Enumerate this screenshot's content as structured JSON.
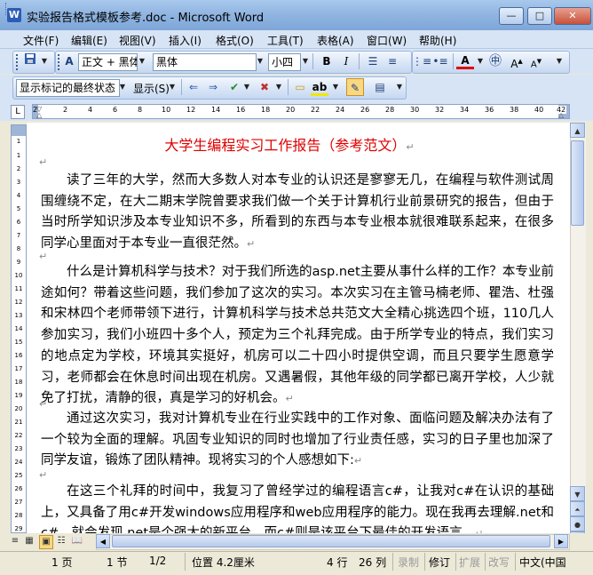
{
  "window": {
    "title": "实验报告格式模板参考.doc - Microsoft Word",
    "app_icon": "W",
    "minimize_glyph": "—",
    "maximize_glyph": "□",
    "close_glyph": "✕"
  },
  "menu": [
    "文件(F)",
    "编辑(E)",
    "视图(V)",
    "插入(I)",
    "格式(O)",
    "工具(T)",
    "表格(A)",
    "窗口(W)",
    "帮助(H)"
  ],
  "formatting": {
    "style": "正文 + 黑体",
    "font": "黑体",
    "size": "小四",
    "bold_glyph": "B",
    "italic_glyph": "I"
  },
  "reviewing": {
    "display": "显示标记的最终状态",
    "show": "显示(S)"
  },
  "ruler": {
    "corner_glyph": "L",
    "ticks": [
      "2",
      "2",
      "4",
      "6",
      "8",
      "10",
      "12",
      "14",
      "16",
      "18",
      "20",
      "22",
      "24",
      "26",
      "28",
      "30",
      "32",
      "34",
      "36",
      "38",
      "40",
      "42"
    ]
  },
  "vruler_ticks": [
    "1",
    "1",
    "2",
    "3",
    "4",
    "5",
    "6",
    "7",
    "8",
    "9",
    "10",
    "11",
    "12",
    "13",
    "14",
    "15",
    "16",
    "17",
    "18",
    "19",
    "20",
    "21",
    "22",
    "23",
    "24",
    "25",
    "26",
    "27",
    "28",
    "29"
  ],
  "document": {
    "title": "大学生编程实习工作报告（参考范文）",
    "paragraphs": [
      "读了三年的大学，然而大多数人对本专业的认识还是寥寥无几，在编程与软件测试周围缠绕不定，在大二期末学院曾要求我们做一个关于计算机行业前景研究的报告，但由于当时所学知识涉及本专业知识不多，所看到的东西与本专业根本就很难联系起来，在很多同学心里面对于本专业一直很茫然。",
      "什么是计算机科学与技术？对于我们所选的asp.net主要从事什么样的工作？本专业前途如何？带着这些问题，我们参加了这次的实习。本次实习在主管马楠老师、瞿浩、杜强和宋林四个老师带领下进行，计算机科学与技术总共范文大全精心挑选四个班，110几人参加实习，我们小班四十多个人，预定为三个礼拜完成。由于所学专业的特点，我们实习的地点定为学校，环境其实挺好，机房可以二十四小时提供空调，而且只要学生愿意学习，老师都会在休息时间出现在机房。又遇暑假，其他年级的同学都已离开学校，人少就免了打扰，清静的很，真是学习的好机会。",
      "通过这次实习，我对计算机专业在行业实践中的工作对象、面临问题及解决办法有了一个较为全面的理解。巩固专业知识的同时也增加了行业责任感，实习的日子里也加深了同学友谊，锻炼了团队精神。现将实习的个人感想如下:",
      "在这三个礼拜的时间中，我复习了曾经学过的编程语言c#，让我对c#在认识的基础上，又具备了用c#开发windows应用程序和web应用程序的能力。现在我再去理解.net和c#，就会发现.net是个强大的新平台，而c#则是该平台下最佳的开发语言。"
    ],
    "paragraph_mark": "↵"
  },
  "status": {
    "page": "1 页",
    "section": "1 节",
    "page_of": "1/2",
    "position": "位置 4.2厘米",
    "line": "4 行",
    "column": "26 列",
    "rec": "录制",
    "trk": "修订",
    "ext": "扩展",
    "ovr": "改写",
    "language": "中文(中国"
  },
  "colors": {
    "title_red": "#E00000",
    "toolbar_blue": "#D7E4F5"
  }
}
